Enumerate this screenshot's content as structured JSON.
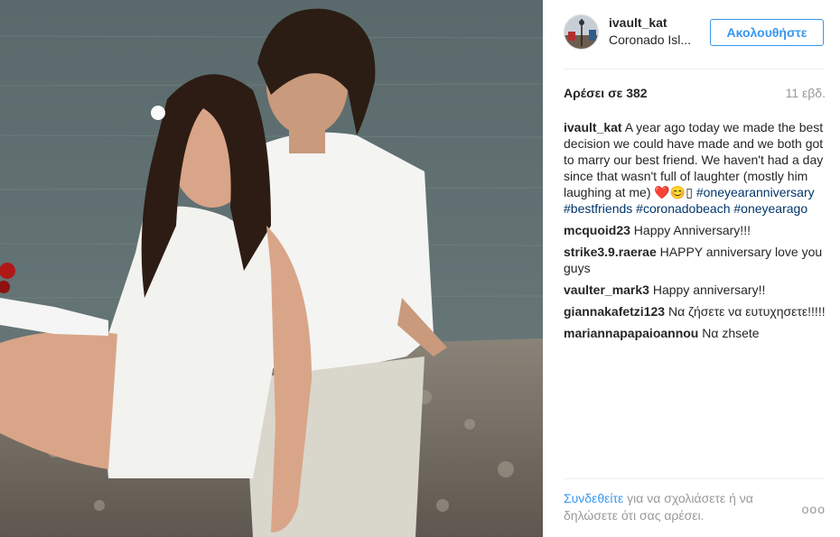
{
  "post": {
    "username": "ivault_kat",
    "location": "Coronado Isl...",
    "follow_label": "Ακολουθήστε",
    "likes": "Αρέσει σε 382",
    "time_ago": "11 εβδ."
  },
  "caption": {
    "user": "ivault_kat",
    "text": "A year ago today we made the best decision we could have made and we both got to marry our best friend. We haven't had a day since that wasn't full of laughter (mostly him laughing at me) ❤️😊▯",
    "tags": [
      "#oneyearanniversary",
      "#bestfriends",
      "#coronadobeach",
      "#oneyearago"
    ]
  },
  "comments": [
    {
      "user": "mcquoid23",
      "text": "Happy Anniversary!!!"
    },
    {
      "user": "strike3.9.raerae",
      "text": "HAPPY anniversary love you guys"
    },
    {
      "user": "vaulter_mark3",
      "text": "Happy anniversary!!"
    },
    {
      "user": "giannakafetzi123",
      "text": "Να ζήσετε να ευτυχησετε!!!!!"
    },
    {
      "user": "mariannapapaioannou",
      "text": "Να zhsete"
    }
  ],
  "footer": {
    "login_link": "Συνδεθείτε",
    "rest": " για να σχολιάσετε ή να δηλώσετε ότι σας αρέσει.",
    "more": "ooo"
  },
  "icons": {
    "more": "more-options-icon"
  },
  "colors": {
    "accent": "#3897f0",
    "hashtag": "#003569",
    "muted": "#999999",
    "text": "#262626"
  }
}
